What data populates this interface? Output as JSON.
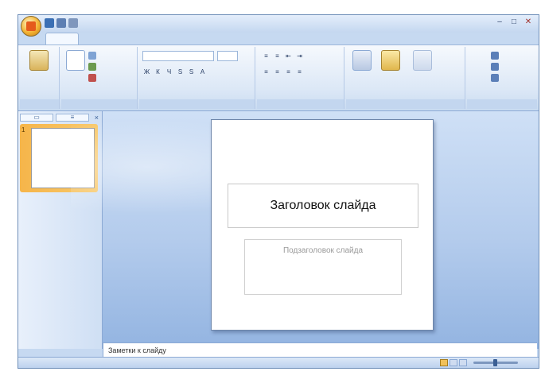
{
  "colors": {
    "window_bg": "#c6d9f1",
    "ribbon_border": "#8ba9d4",
    "thumb_selected": "#f6b54a",
    "text_accent": "#15428b"
  },
  "slide": {
    "title_placeholder": "Заголовок слайда",
    "subtitle_placeholder": "Подзаголовок слайда"
  },
  "notes": {
    "placeholder": "Заметки к слайду"
  },
  "slides_pane": {
    "thumbnail_number": "1"
  },
  "icons": {
    "office_button": "office-logo-icon",
    "save": "save-icon",
    "undo": "undo-icon",
    "redo": "redo-icon",
    "paste": "paste-icon",
    "new_slide": "new-slide-icon",
    "shapes": "shapes-icon",
    "arrange": "arrange-icon",
    "find": "find-icon",
    "minimize": "minimize-icon",
    "maximize": "maximize-icon",
    "close": "close-icon"
  }
}
